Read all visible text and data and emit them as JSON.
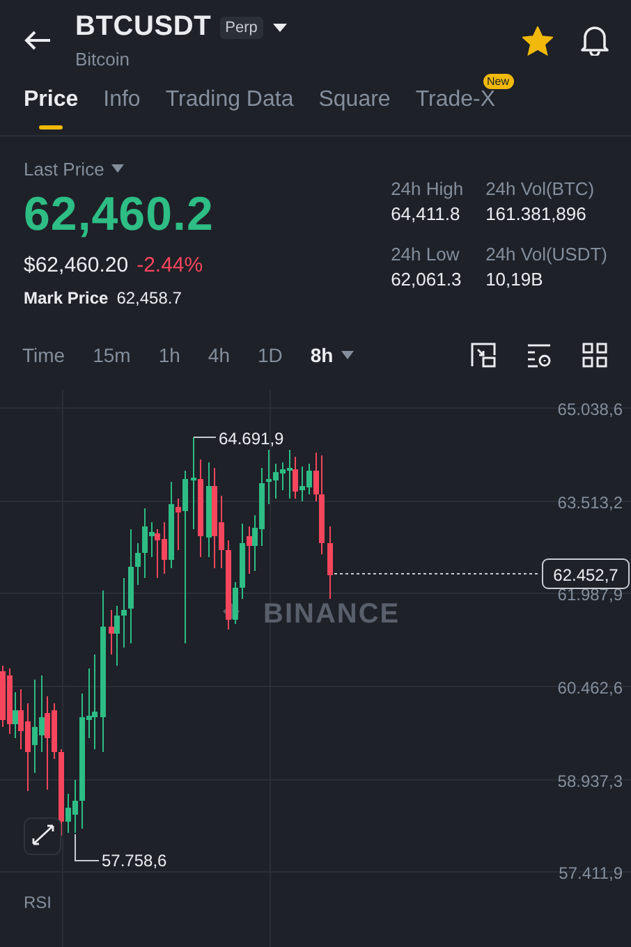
{
  "header": {
    "symbol": "BTCUSDT",
    "badge": "Perp",
    "name": "Bitcoin",
    "favorite": true
  },
  "tabs": [
    {
      "label": "Price",
      "selected": true
    },
    {
      "label": "Info",
      "selected": false
    },
    {
      "label": "Trading Data",
      "selected": false
    },
    {
      "label": "Square",
      "selected": false
    },
    {
      "label": "Trade-X",
      "selected": false,
      "badge": "New"
    }
  ],
  "summary": {
    "price_label": "Last Price",
    "last_price": "62,460.2",
    "usd_price": "$62,460.20",
    "change": "-2.44%",
    "mark_label": "Mark Price",
    "mark_price": "62,458.7",
    "stats": [
      {
        "label": "24h High",
        "value": "64,411.8"
      },
      {
        "label": "24h Vol(BTC)",
        "value": "161.381,896"
      },
      {
        "label": "24h Low",
        "value": "62,061.3"
      },
      {
        "label": "24h Vol(USDT)",
        "value": "10,19B"
      }
    ]
  },
  "intervals": [
    {
      "label": "Time",
      "selected": false,
      "dropdown": false
    },
    {
      "label": "15m",
      "selected": false,
      "dropdown": false
    },
    {
      "label": "1h",
      "selected": false,
      "dropdown": false
    },
    {
      "label": "4h",
      "selected": false,
      "dropdown": false
    },
    {
      "label": "1D",
      "selected": false,
      "dropdown": false
    },
    {
      "label": "8h",
      "selected": true,
      "dropdown": true
    }
  ],
  "chart": {
    "price_axis": [
      "65.038,6",
      "63.513,2",
      "61.987,9",
      "60.462,6",
      "58.937,3",
      "57.411,9"
    ],
    "high_label": "64.691,9",
    "low_label": "57.758,6",
    "current_price": "62.452,7",
    "watermark": "BINANCE",
    "indicator": "RSI"
  }
}
